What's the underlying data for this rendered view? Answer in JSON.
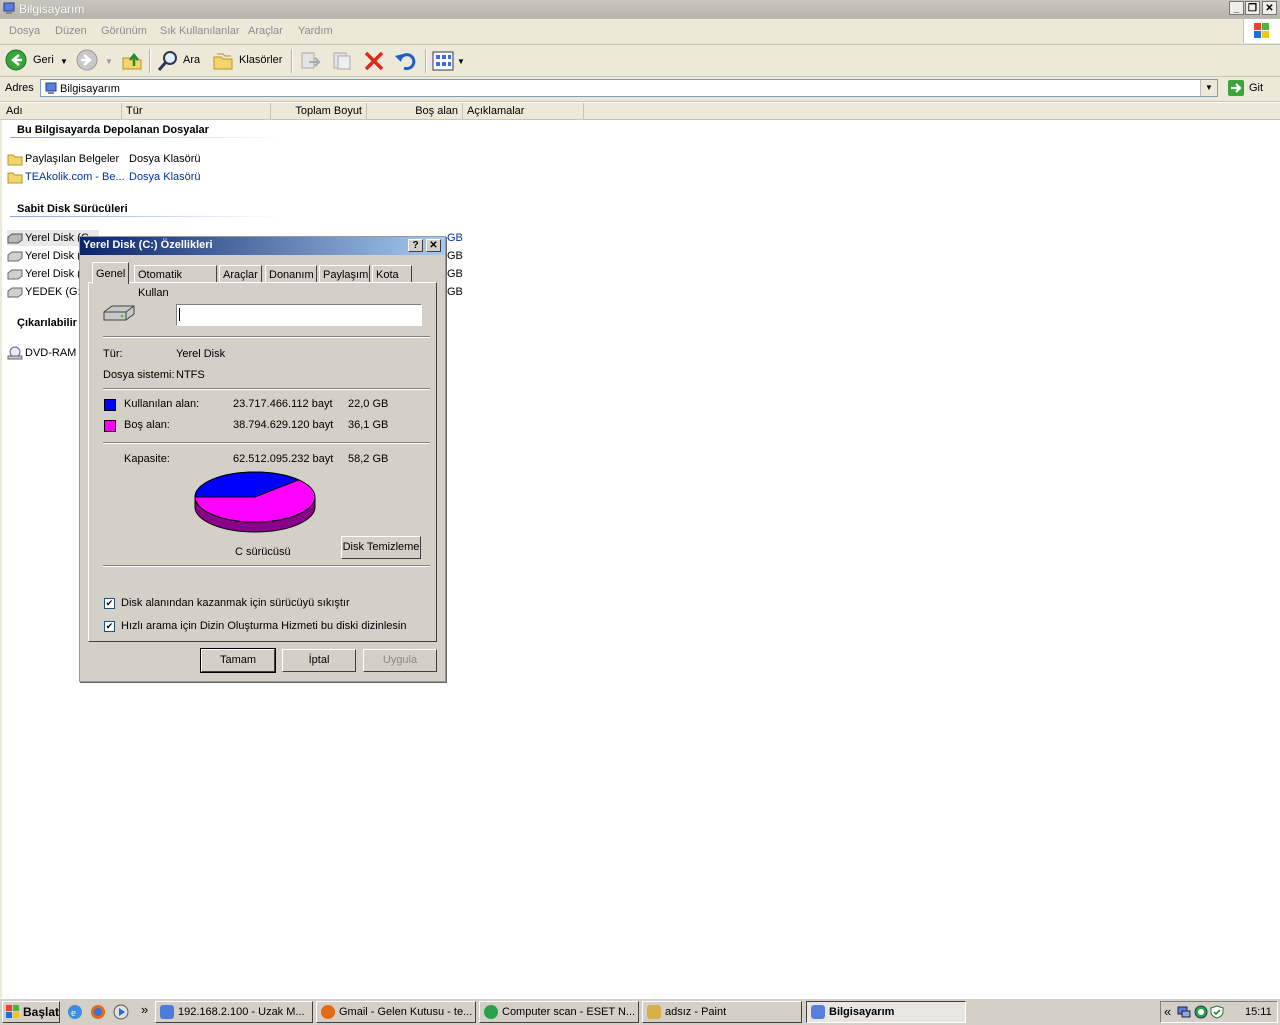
{
  "window": {
    "title": "Bilgisayarım",
    "minimize_label": "_",
    "maximize_label": "❐",
    "close_label": "✕"
  },
  "menu": [
    "Dosya",
    "Düzen",
    "Görünüm",
    "Sık Kullanılanlar",
    "Araçlar",
    "Yardım"
  ],
  "toolbar": {
    "back_label": "Geri",
    "search_label": "Ara",
    "folders_label": "Klasörler"
  },
  "address": {
    "label": "Adres",
    "value": "Bilgisayarım",
    "go_label": "Git"
  },
  "columns": [
    "Adı",
    "Tür",
    "Toplam Boyut",
    "Boş alan",
    "Açıklamalar"
  ],
  "groups": {
    "stored_files": "Bu Bilgisayarda Depolanan Dosyalar",
    "hard_disks": "Sabit Disk Sürücüleri",
    "removable": "Çıkarılabilir"
  },
  "stored_items": [
    {
      "name": "Paylaşılan Belgeler",
      "type": "Dosya Klasörü"
    },
    {
      "name": "TEAkolik.com - Be...",
      "type": "Dosya Klasörü"
    }
  ],
  "disk_items": [
    {
      "name": "Yerel Disk (C",
      "right": "GB"
    },
    {
      "name": "Yerel Disk (D",
      "right": "GB"
    },
    {
      "name": "Yerel Disk (E",
      "right": "GB"
    },
    {
      "name": "YEDEK (G:)",
      "right": "GB"
    }
  ],
  "removable_items": [
    {
      "name": "DVD-RAM S"
    }
  ],
  "dialog": {
    "title": "Yerel Disk (C:) Özellikleri",
    "help_label": "?",
    "close_label": "✕",
    "tabs": [
      "Genel",
      "Otomatik Kullan",
      "Araçlar",
      "Donanım",
      "Paylaşım",
      "Kota"
    ],
    "name_value": "",
    "type_label": "Tür:",
    "type_value": "Yerel Disk",
    "fs_label": "Dosya sistemi:",
    "fs_value": "NTFS",
    "used_label": "Kullanılan alan:",
    "used_bytes": "23.717.466.112 bayt",
    "used_gb": "22,0 GB",
    "free_label": "Boş alan:",
    "free_bytes": "38.794.629.120 bayt",
    "free_gb": "36,1 GB",
    "capacity_label": "Kapasite:",
    "capacity_bytes": "62.512.095.232 bayt",
    "capacity_gb": "58,2 GB",
    "drive_label": "C sürücüsü",
    "cleanup_label": "Disk Temizleme",
    "compress_label": "Disk alanından kazanmak için sürücüyü sıkıştır",
    "index_label": "Hızlı arama için Dizin Oluşturma Hizmeti bu diski dizinlesin",
    "compress_checked": true,
    "index_checked": true,
    "ok_label": "Tamam",
    "cancel_label": "İptal",
    "apply_label": "Uygula",
    "used_color": "#0000ff",
    "free_color": "#ff00ff",
    "used_fraction": 0.3794
  },
  "taskbar": {
    "start_label": "Başlat",
    "quick_more": "»",
    "tasks": [
      {
        "label": "192.168.2.100 - Uzak M...",
        "active": false
      },
      {
        "label": "Gmail - Gelen Kutusu - te...",
        "active": false
      },
      {
        "label": "Computer scan - ESET N...",
        "active": false
      },
      {
        "label": "adsız - Paint",
        "active": false
      },
      {
        "label": "Bilgisayarım",
        "active": true
      }
    ],
    "tray_more": "«",
    "clock": "15:11"
  }
}
